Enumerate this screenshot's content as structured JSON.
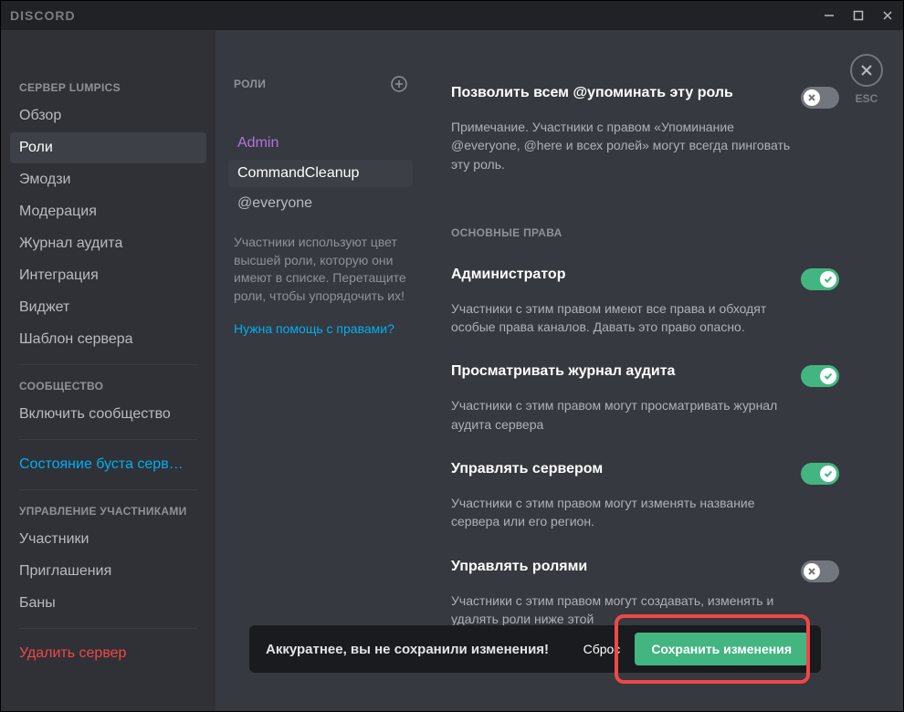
{
  "titlebar": {
    "brand": "DISCORD"
  },
  "esc_label": "ESC",
  "sidebar": {
    "server_header": "СЕРВЕР LUMPICS",
    "items": [
      {
        "label": "Обзор"
      },
      {
        "label": "Роли",
        "selected": true
      },
      {
        "label": "Эмодзи"
      },
      {
        "label": "Модерация"
      },
      {
        "label": "Журнал аудита"
      },
      {
        "label": "Интеграция"
      },
      {
        "label": "Виджет"
      },
      {
        "label": "Шаблон сервера"
      }
    ],
    "community_header": "СООБЩЕСТВО",
    "community_item": "Включить сообщество",
    "boost_item": "Состояние буста серв…",
    "manage_header": "УПРАВЛЕНИЕ УЧАСТНИКАМИ",
    "manage_items": [
      {
        "label": "Участники"
      },
      {
        "label": "Приглашения"
      },
      {
        "label": "Баны"
      }
    ],
    "delete_item": "Удалить сервер"
  },
  "roles": {
    "header": "РОЛИ",
    "list": [
      {
        "label": "Admin",
        "class": "admin"
      },
      {
        "label": "CommandCleanup",
        "selected": true
      },
      {
        "label": "@everyone"
      }
    ],
    "note": "Участники используют цвет высшей роли, которую они имеют в списке. Перетащите роли, чтобы упорядочить их!",
    "help": "Нужна помощь с правами?"
  },
  "perms": {
    "mention": {
      "title": "Позволить всем @упоминать эту роль",
      "desc": "Примечание. Участники с правом «Упоминание @everyone, @here и всех ролей» могут всегда пинговать эту роль.",
      "enabled": false
    },
    "section_label": "ОСНОВНЫЕ ПРАВА",
    "admin": {
      "title": "Администратор",
      "desc": "Участники с этим правом имеют все права и обходят особые права каналов. Давать это право опасно.",
      "enabled": true
    },
    "audit": {
      "title": "Просматривать журнал аудита",
      "desc": "Участники с этим правом могут просматривать журнал аудита сервера",
      "enabled": true
    },
    "server": {
      "title": "Управлять сервером",
      "desc": "Участники с этим правом могут изменять название сервера или его регион.",
      "enabled": true
    },
    "rolesmgr": {
      "title": "Управлять ролями",
      "desc": "Участники с этим правом могут создавать, изменять и удалять роли ниже этой",
      "enabled": false
    }
  },
  "savebar": {
    "msg": "Аккуратнее, вы не сохранили изменения!",
    "reset": "Сброс",
    "save": "Сохранить изменения"
  }
}
